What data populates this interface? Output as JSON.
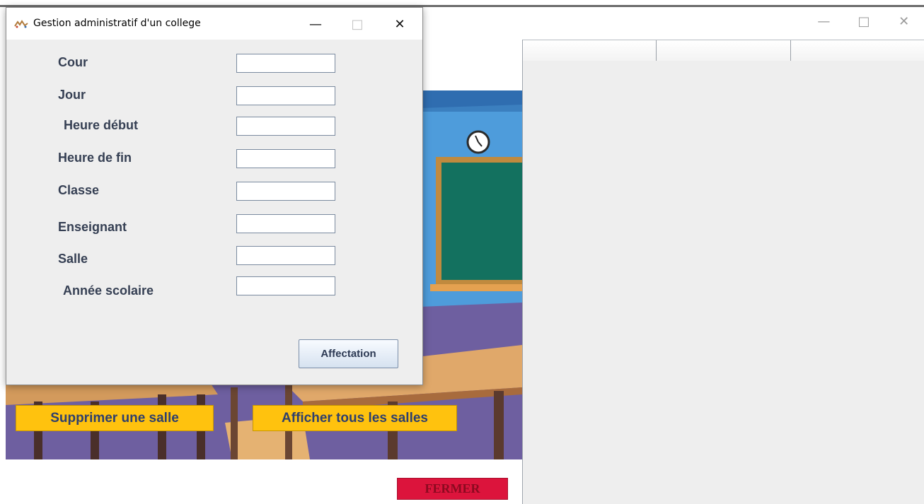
{
  "background_window": {
    "controls": {
      "minimize": "—",
      "maximize": "□",
      "close": "✕"
    },
    "table_columns": [
      "",
      "",
      ""
    ],
    "buttons": {
      "supprimer_salle": "Supprimer une salle",
      "afficher_salles": "Afficher tous les salles",
      "fermer": "FERMER"
    },
    "colors": {
      "yellow_button": "#ffc20e",
      "fermer_button": "#dc143c",
      "table_bg": "#eeeeee"
    }
  },
  "dialog": {
    "title": "Gestion administratif d'un college",
    "controls": {
      "minimize": "—",
      "maximize": "□",
      "close": "✕"
    },
    "fields": [
      {
        "label": "Cour",
        "value": ""
      },
      {
        "label": "Jour",
        "value": ""
      },
      {
        "label": "Heure début",
        "value": ""
      },
      {
        "label": "Heure de fin",
        "value": ""
      },
      {
        "label": "Classe",
        "value": ""
      },
      {
        "label": "Enseignant",
        "value": ""
      },
      {
        "label": "Salle",
        "value": ""
      },
      {
        "label": "Année scolaire",
        "value": ""
      }
    ],
    "submit_label": "Affectation"
  }
}
